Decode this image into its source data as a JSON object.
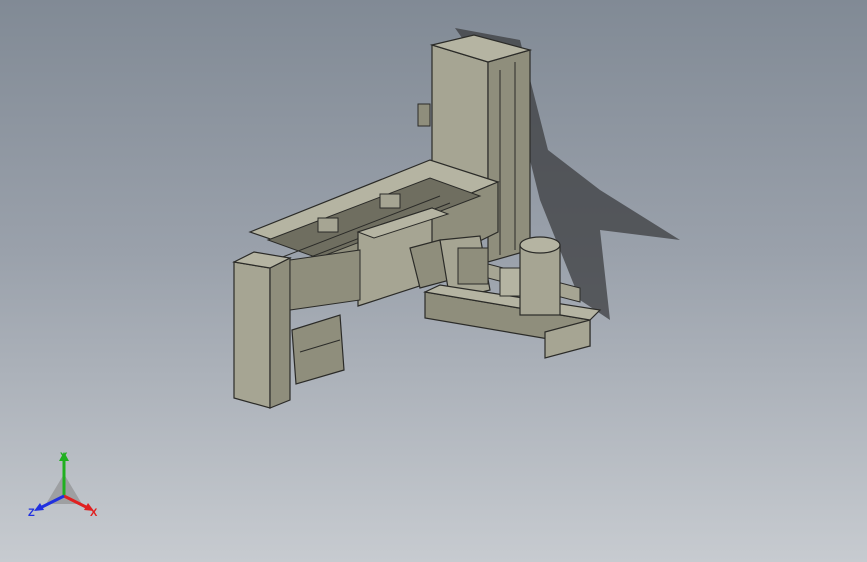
{
  "colors": {
    "background_top": "#818a95",
    "background_bottom": "#c7cbd0",
    "part_light": "#a6a593",
    "part_mid": "#8f8e7c",
    "part_dark": "#6f6e60",
    "edge": "#2b2b28",
    "shadow": "#3c3e40",
    "axis_x": "#e02020",
    "axis_y": "#20b020",
    "axis_z": "#2030e0"
  },
  "triad": {
    "x_label": "X",
    "y_label": "Y",
    "z_label": "Z",
    "icon": "coordinate-triad-icon"
  }
}
